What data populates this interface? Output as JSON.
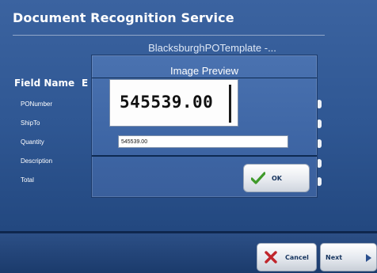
{
  "app": {
    "title": "Document Recognition Service",
    "template_name": "BlacksburghPOTemplate -..."
  },
  "fields": {
    "header": "Field Name",
    "header_partial": "E",
    "items": [
      {
        "label": "PONumber"
      },
      {
        "label": "ShipTo"
      },
      {
        "label": "Quantity"
      },
      {
        "label": "Description"
      },
      {
        "label": "Total"
      }
    ]
  },
  "dialog": {
    "title": "Image Preview",
    "preview_text": "545539.00",
    "ocr_value": "545539.00",
    "ok_label": "OK"
  },
  "footer": {
    "cancel_label": "Cancel",
    "next_label": "Next"
  },
  "icons": {
    "cancel": "x-icon",
    "ok": "checkmark-icon",
    "next": "right-arrow-icon"
  },
  "colors": {
    "background": "#2f5793",
    "cancel_x": "#c0262c",
    "check": "#3f9a2a"
  }
}
